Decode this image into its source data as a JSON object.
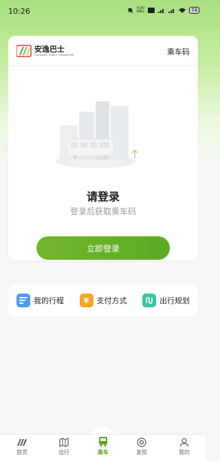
{
  "status": {
    "time": "10:26",
    "battery": "74"
  },
  "header": {
    "brand_cn": "安逸巴士",
    "brand_en": "CHENGDU PUBLIC TRANSPORT",
    "ride_code_link": "乘车码"
  },
  "login": {
    "title": "请登录",
    "subtitle": "登录后获取乘车码",
    "button": "立即登录"
  },
  "quick": [
    {
      "label": "我的行程",
      "icon": "trip-list-icon",
      "color": "#4a9df0"
    },
    {
      "label": "支付方式",
      "icon": "yuan-icon",
      "color": "#f5a623"
    },
    {
      "label": "出行规划",
      "icon": "route-plan-icon",
      "color": "#3cc4a0"
    }
  ],
  "tabs": [
    {
      "label": "首页",
      "icon": "home-logo-icon"
    },
    {
      "label": "出行",
      "icon": "map-icon"
    },
    {
      "label": "乘车",
      "icon": "bus-qr-icon"
    },
    {
      "label": "发现",
      "icon": "discover-icon"
    },
    {
      "label": "我的",
      "icon": "profile-icon"
    }
  ],
  "colors": {
    "accent": "#5cab22",
    "accent_light": "#72b52b"
  }
}
